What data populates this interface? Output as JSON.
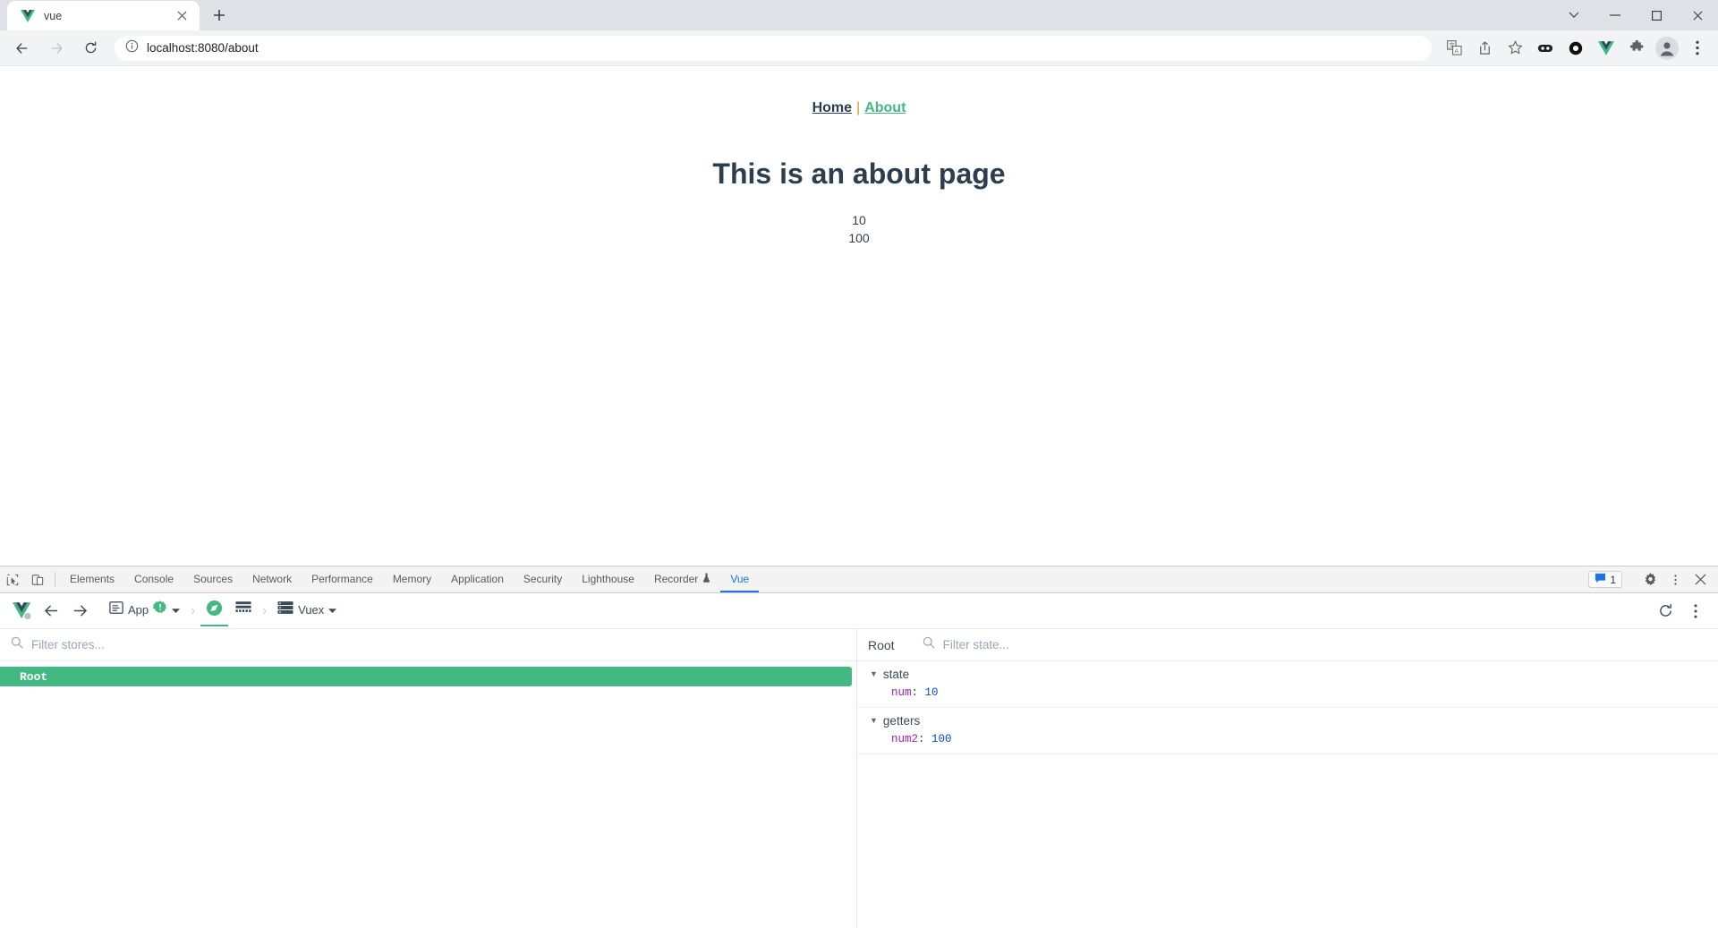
{
  "browser": {
    "tab": {
      "title": "vue",
      "favicon": "vue-logo-icon",
      "close_icon": "close-icon"
    },
    "new_tab_icon": "plus-icon",
    "window_controls": [
      "tab-search-chevron-icon",
      "minimize-icon",
      "maximize-icon",
      "close-window-icon"
    ],
    "nav": {
      "back_icon": "back-arrow-icon",
      "forward_icon": "forward-arrow-icon",
      "reload_icon": "reload-icon"
    },
    "omnibox": {
      "info_icon": "site-info-icon",
      "url_host": "localhost:8080",
      "url_path": "/about",
      "url_full": "localhost:8080/about"
    },
    "toolbar_icons": [
      "translate-icon",
      "share-icon",
      "bookmark-star-icon",
      "extension-dark-icon",
      "extension-ring-icon",
      "vue-devtools-icon",
      "puzzle-extensions-icon",
      "profile-avatar-icon",
      "chrome-menu-icon"
    ]
  },
  "page": {
    "nav": {
      "home_label": "Home",
      "separator": "|",
      "about_label": "About",
      "active": "About"
    },
    "title": "This is an about page",
    "values": [
      "10",
      "100"
    ],
    "colors": {
      "heading": "#2c3e50",
      "active_link": "#42b983"
    }
  },
  "devtools": {
    "tools": [
      "inspect-element-icon",
      "device-toolbar-icon"
    ],
    "tabs": [
      {
        "label": "Elements",
        "active": false
      },
      {
        "label": "Console",
        "active": false
      },
      {
        "label": "Sources",
        "active": false
      },
      {
        "label": "Network",
        "active": false
      },
      {
        "label": "Performance",
        "active": false
      },
      {
        "label": "Memory",
        "active": false
      },
      {
        "label": "Application",
        "active": false
      },
      {
        "label": "Security",
        "active": false
      },
      {
        "label": "Lighthouse",
        "active": false
      },
      {
        "label": "Recorder",
        "active": false,
        "icon": "experiment-flask-icon"
      },
      {
        "label": "Vue",
        "active": true
      }
    ],
    "right": {
      "message_count": "1",
      "message_icon": "message-bubble-icon",
      "settings_icon": "gear-icon",
      "more_icon": "dots-vertical-icon",
      "close_icon": "close-devtools-icon"
    }
  },
  "vue_devtools": {
    "toolbar": {
      "logo_icon": "vue-logo-icon",
      "back_icon": "arrow-left-icon",
      "forward_icon": "arrow-right-icon",
      "app_panel_icon": "component-panel-icon",
      "app_label": "App",
      "app_badge": "!",
      "app_dropdown_icon": "chevron-down-icon",
      "separator_icon": "chevron-right-icon",
      "inspector_icon": "compass-inspector-icon",
      "timeline_icon": "timeline-icon",
      "plugin_icon": "vuex-list-icon",
      "plugin_label": "Vuex",
      "plugin_dropdown_icon": "chevron-down-icon",
      "refresh_icon": "refresh-icon",
      "more_icon": "dots-vertical-icon"
    },
    "left_panel": {
      "search_icon": "search-icon",
      "filter_placeholder": "Filter stores...",
      "filter_value": "",
      "stores": [
        {
          "label": "Root",
          "selected": true
        }
      ]
    },
    "right_panel": {
      "title": "Root",
      "search_icon": "search-icon",
      "filter_placeholder": "Filter state...",
      "filter_value": "",
      "groups": [
        {
          "name": "state",
          "expanded": true,
          "entries": [
            {
              "key": "num",
              "value": "10"
            }
          ]
        },
        {
          "name": "getters",
          "expanded": true,
          "entries": [
            {
              "key": "num2",
              "value": "100"
            }
          ]
        }
      ]
    },
    "colors": {
      "accent": "#42b883",
      "key": "#a020c0",
      "value": "#0d47d9"
    }
  }
}
